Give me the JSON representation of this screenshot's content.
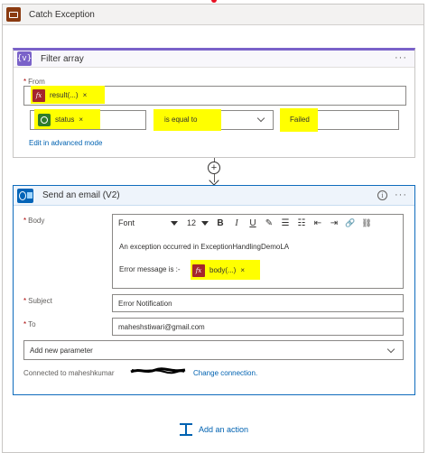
{
  "scope": {
    "title": "Catch Exception"
  },
  "filter": {
    "title": "Filter array",
    "more": "···",
    "from_label": "From",
    "from_token": {
      "label": "result(...)",
      "remove": "×"
    },
    "condition": {
      "left_token": {
        "label": "status",
        "remove": "×"
      },
      "operator": "is equal to",
      "right_value": "Failed"
    },
    "advanced_link": "Edit in advanced mode"
  },
  "connector": {
    "plus": "+"
  },
  "email": {
    "title": "Send an email (V2)",
    "info": "i",
    "more": "···",
    "body_label": "Body",
    "toolbar": {
      "font": "Font",
      "size": "12",
      "bold": "B",
      "italic": "I",
      "underline": "U",
      "pen": "✎",
      "bullets": "☰",
      "numbers": "☷",
      "outdent": "⇤",
      "indent": "⇥",
      "link": "🔗",
      "unlink": "⛓"
    },
    "body_line1": "An exception occurred in ExceptionHandlingDemoLA",
    "body_line2": "Error message is :-",
    "body_token": {
      "label": "body(...)",
      "remove": "×"
    },
    "subject_label": "Subject",
    "subject_value": "Error Notification",
    "to_label": "To",
    "to_value": "maheshstiwari@gmail.com",
    "add_param": "Add new parameter",
    "connected": "Connected to maheshkumar",
    "change_link": "Change connection."
  },
  "add_action": "Add an action",
  "colors": {
    "highlight": "#ffff00",
    "filter_accent": "#7a62c9",
    "email_accent": "#0f6cbd",
    "link": "#0062b1",
    "fx": "#a4262c",
    "scope_icon": "#8a3a10"
  }
}
